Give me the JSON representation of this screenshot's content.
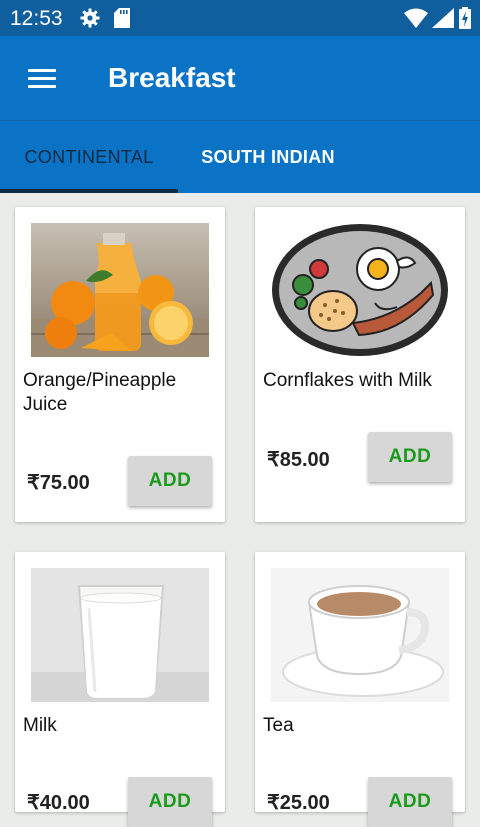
{
  "status": {
    "time": "12:53"
  },
  "appbar": {
    "title": "Breakfast"
  },
  "tabs": [
    {
      "label": "CONTINENTAL",
      "selected": true
    },
    {
      "label": "SOUTH INDIAN",
      "selected": false
    }
  ],
  "items": [
    {
      "name": "Orange/Pineapple Juice",
      "price": "₹75.00",
      "add_label": "ADD"
    },
    {
      "name": "Cornflakes with Milk",
      "price": "₹85.00",
      "add_label": "ADD"
    },
    {
      "name": "Milk",
      "price": "₹40.00",
      "add_label": "ADD"
    },
    {
      "name": "Tea",
      "price": "₹25.00",
      "add_label": "ADD"
    }
  ],
  "colors": {
    "statusbar": "#0f5f9e",
    "appbar": "#0a73c6",
    "add_text": "#1a9a1a"
  }
}
